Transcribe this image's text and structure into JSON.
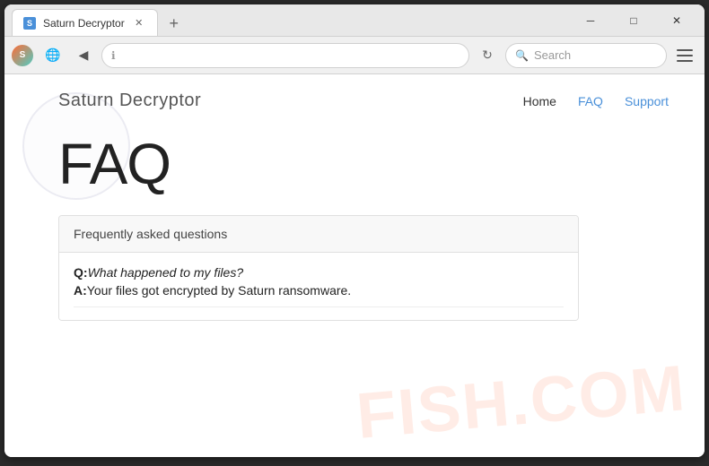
{
  "browser": {
    "title_bar": {
      "tab_title": "Saturn Decryptor",
      "tab_favicon": "S",
      "close_label": "✕",
      "new_tab_label": "+",
      "win_minimize": "─",
      "win_maximize": "□",
      "win_close": "✕"
    },
    "nav_bar": {
      "back_icon": "◀",
      "reload_icon": "↻",
      "info_icon": "ℹ",
      "address_text": "",
      "search_placeholder": "Search",
      "menu_icon": "≡"
    }
  },
  "site": {
    "title": "Saturn Decryptor",
    "nav": {
      "home": "Home",
      "faq": "FAQ",
      "support": "Support"
    }
  },
  "page": {
    "heading": "FAQ",
    "faq_section": {
      "header": "Frequently asked questions",
      "q1_label": "Q:",
      "q1_text": "What happened to my files?",
      "a1_label": "A:",
      "a1_text": "Your files got encrypted by Saturn ransomware."
    }
  },
  "watermark": {
    "text": "FISH.COM"
  }
}
